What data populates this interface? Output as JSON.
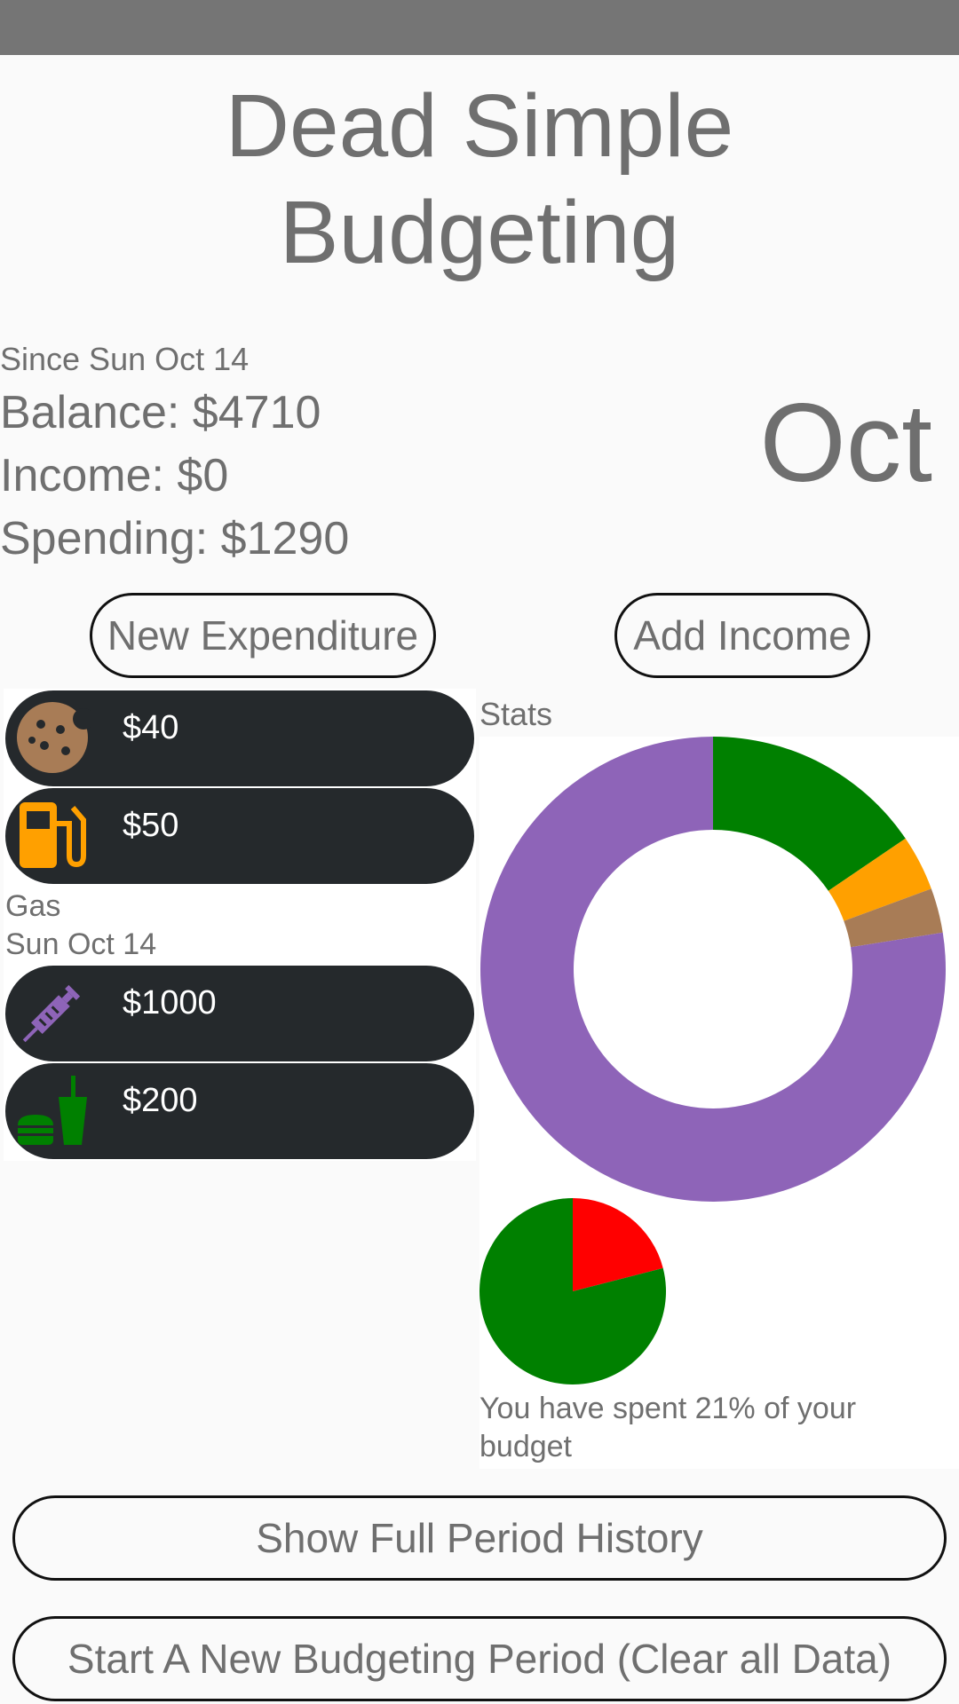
{
  "app": {
    "title_line1": "Dead Simple",
    "title_line2": "Budgeting"
  },
  "summary": {
    "since": "Since Sun Oct 14",
    "balance": "Balance: $4710",
    "income": "Income: $0",
    "spending": "Spending: $1290",
    "month": "Oct"
  },
  "buttons": {
    "new_expenditure": "New Expenditure",
    "add_income": "Add Income",
    "show_history": "Show Full Period History",
    "new_period": "Start A New Budgeting Period (Clear all Data)"
  },
  "expenditures": [
    {
      "icon": "cookie-icon",
      "amount": "$40",
      "color": "#a87c56"
    },
    {
      "icon": "gas-pump-icon",
      "amount": "$50",
      "color": "#ffa000",
      "detail_category": "Gas",
      "detail_date": "Sun Oct 14"
    },
    {
      "icon": "syringe-icon",
      "amount": "$1000",
      "color": "#8e64b8"
    },
    {
      "icon": "fast-food-icon",
      "amount": "$200",
      "color": "#008000"
    }
  ],
  "stats": {
    "label": "Stats",
    "budget_text": "You have spent 21% of your budget"
  },
  "chart_data": [
    {
      "type": "pie",
      "variant": "donut",
      "slices": [
        {
          "value": 200,
          "color": "#008000"
        },
        {
          "value": 50,
          "color": "#ffa000"
        },
        {
          "value": 40,
          "color": "#a87c56"
        },
        {
          "value": 1000,
          "color": "#8e64b8"
        }
      ]
    },
    {
      "type": "pie",
      "slices": [
        {
          "value": 21,
          "color": "#ff0000"
        },
        {
          "value": 79,
          "color": "#008000"
        }
      ]
    }
  ]
}
